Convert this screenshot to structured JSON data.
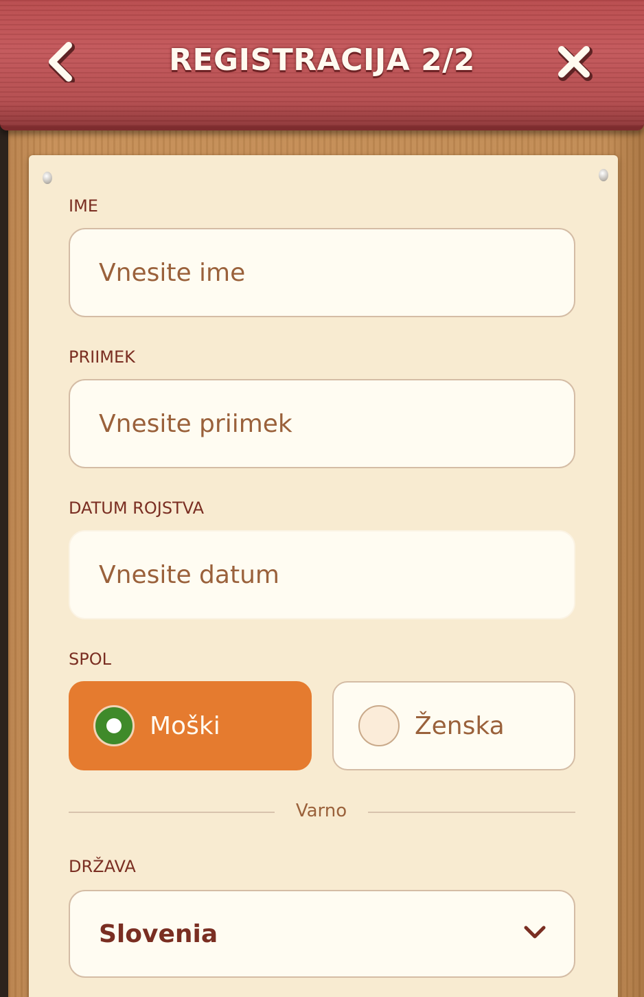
{
  "header": {
    "title": "REGISTRACIJA 2/2",
    "back_icon": "back-arrow-icon",
    "close_icon": "close-x-icon"
  },
  "form": {
    "first_name": {
      "label": "IME",
      "placeholder": "Vnesite ime"
    },
    "last_name": {
      "label": "PRIIMEK",
      "placeholder": "Vnesite priimek"
    },
    "birth_date": {
      "label": "DATUM ROJSTVA",
      "placeholder": "Vnesite datum"
    },
    "gender": {
      "label": "SPOL",
      "options": [
        {
          "label": "Moški",
          "selected": true
        },
        {
          "label": "Ženska",
          "selected": false
        }
      ]
    },
    "divider_text": "Varno",
    "country": {
      "label": "DRŽAVA",
      "value": "Slovenia"
    }
  },
  "colors": {
    "header_red": "#c3575a",
    "paper": "#f8ebd1",
    "accent_orange": "#e57b2f",
    "radio_green": "#3f8a2a",
    "label_brown": "#7a2e22",
    "placeholder_brown": "#9a613b"
  }
}
